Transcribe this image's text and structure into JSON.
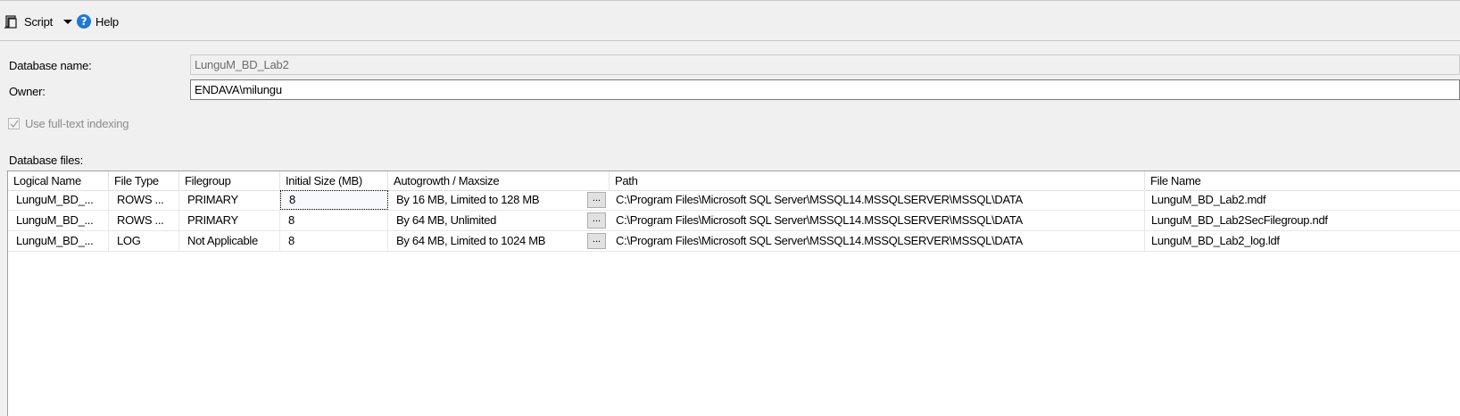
{
  "toolbar": {
    "script_label": "Script",
    "help_label": "Help"
  },
  "form": {
    "database_name_label": "Database name:",
    "database_name_value": "LunguM_BD_Lab2",
    "owner_label": "Owner:",
    "owner_value": "ENDAVA\\milungu",
    "fulltext_label": "Use full-text indexing",
    "fulltext_checked": true,
    "database_files_label": "Database files:"
  },
  "grid": {
    "headers": [
      "Logical Name",
      "File Type",
      "Filegroup",
      "Initial Size (MB)",
      "Autogrowth / Maxsize",
      "Path",
      "File Name"
    ],
    "ellipsis_label": "...",
    "rows": [
      {
        "logical_name": "LunguM_BD_...",
        "file_type": "ROWS ...",
        "filegroup": "PRIMARY",
        "initial_size": "8",
        "autogrowth": "By 16 MB, Limited to 128 MB",
        "path": "C:\\Program Files\\Microsoft SQL Server\\MSSQL14.MSSQLSERVER\\MSSQL\\DATA",
        "file_name": "LunguM_BD_Lab2.mdf"
      },
      {
        "logical_name": "LunguM_BD_...",
        "file_type": "ROWS ...",
        "filegroup": "PRIMARY",
        "initial_size": "8",
        "autogrowth": "By 64 MB, Unlimited",
        "path": "C:\\Program Files\\Microsoft SQL Server\\MSSQL14.MSSQLSERVER\\MSSQL\\DATA",
        "file_name": "LunguM_BD_Lab2SecFilegroup.ndf"
      },
      {
        "logical_name": "LunguM_BD_...",
        "file_type": "LOG",
        "filegroup": "Not Applicable",
        "initial_size": "8",
        "autogrowth": "By 64 MB, Limited to 1024 MB",
        "path": "C:\\Program Files\\Microsoft SQL Server\\MSSQL14.MSSQLSERVER\\MSSQL\\DATA",
        "file_name": "LunguM_BD_Lab2_log.ldf"
      }
    ]
  }
}
